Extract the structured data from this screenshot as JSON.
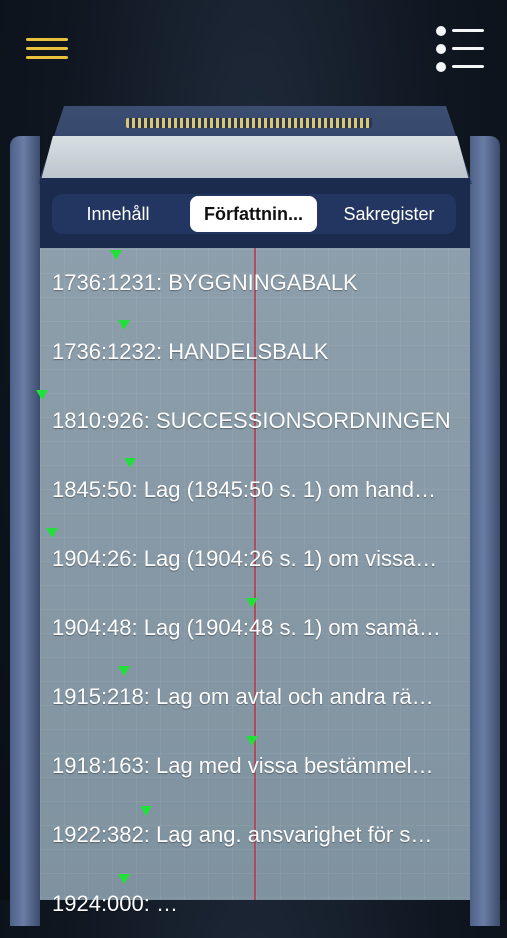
{
  "colors": {
    "accent": "#e8c23a",
    "marker": "#22e03a",
    "tab_active_bg": "#ffffff",
    "tab_bar": "#1b2b4d"
  },
  "header": {
    "menu_icon": "hamburger-menu-icon",
    "list_icon": "bulleted-list-icon"
  },
  "tabs": [
    {
      "label": "Innehåll",
      "active": false
    },
    {
      "label": "Författnin...",
      "active": true
    },
    {
      "label": "Sakregister",
      "active": false
    }
  ],
  "list": [
    {
      "text": "1736:1231: BYGGNINGABALK"
    },
    {
      "text": "1736:1232: HANDELSBALK"
    },
    {
      "text": "1810:926: SUCCESSIONSORDNINGEN"
    },
    {
      "text": "1845:50: Lag (1845:50 s. 1) om hand…"
    },
    {
      "text": "1904:26: Lag (1904:26 s. 1) om vissa…"
    },
    {
      "text": "1904:48: Lag (1904:48 s. 1) om samä…"
    },
    {
      "text": "1915:218: Lag om avtal och andra rä…"
    },
    {
      "text": "1918:163: Lag med vissa bestämmel…"
    },
    {
      "text": "1922:382: Lag ang. ansvarighet för s…"
    },
    {
      "text": "1924:000: …"
    }
  ]
}
